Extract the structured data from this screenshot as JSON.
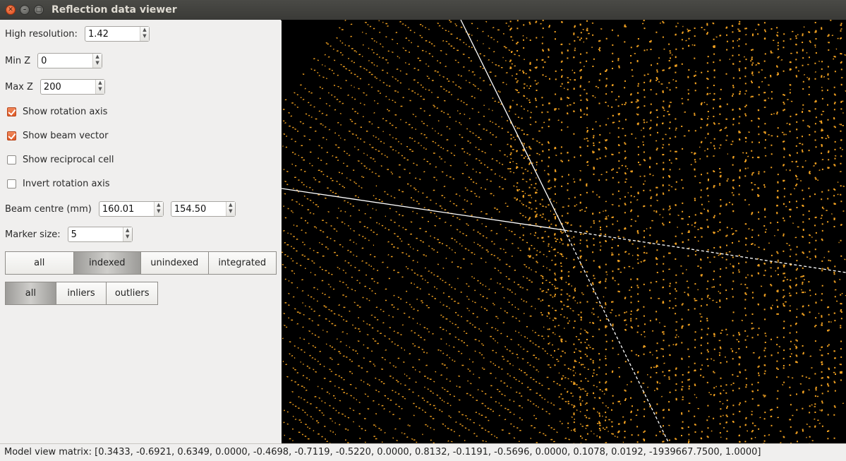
{
  "window": {
    "title": "Reflection data viewer"
  },
  "controls": {
    "high_resolution": {
      "label": "High resolution:",
      "value": "1.42"
    },
    "min_z": {
      "label": "Min Z",
      "value": "0"
    },
    "max_z": {
      "label": "Max Z",
      "value": "200"
    },
    "show_rotation_axis": {
      "label": "Show rotation axis",
      "checked": true
    },
    "show_beam_vector": {
      "label": "Show beam vector",
      "checked": true
    },
    "show_reciprocal_cell": {
      "label": "Show reciprocal cell",
      "checked": false
    },
    "invert_rotation_axis": {
      "label": "Invert rotation axis",
      "checked": false
    },
    "beam_centre": {
      "label": "Beam centre (mm)",
      "x": "160.01",
      "y": "154.50"
    },
    "marker_size": {
      "label": "Marker size:",
      "value": "5"
    },
    "filter_index": {
      "options": [
        "all",
        "indexed",
        "unindexed",
        "integrated"
      ],
      "selected": "indexed"
    },
    "filter_outlier": {
      "options": [
        "all",
        "inliers",
        "outliers"
      ],
      "selected": "all"
    }
  },
  "viewer": {
    "background": "#000000",
    "spot_color": "#f0a020",
    "axis_color": "#ffffff"
  },
  "status_bar": {
    "text": "Model view matrix: [0.3433, -0.6921, 0.6349, 0.0000, -0.4698, -0.7119, -0.5220, 0.0000, 0.8132, -0.1191, -0.5696, 0.0000, 0.1078, 0.0192, -1939667.7500, 1.0000]"
  }
}
